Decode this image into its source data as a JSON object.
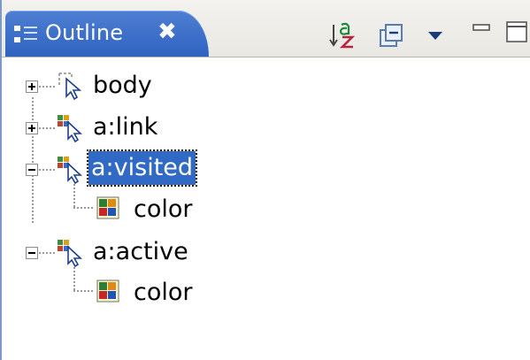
{
  "view": {
    "tab_title": "Outline",
    "close_glyph": "✖",
    "toolbar": {
      "sort_icon": "sort-alphabetically-icon",
      "collapse_icon": "collapse-all-icon",
      "menu_icon": "view-menu-dropdown-icon",
      "minimize_icon": "minimize-icon",
      "maximize_icon": "maximize-icon"
    }
  },
  "tree": {
    "nodes": [
      {
        "label": "body",
        "icon": "selector-icon",
        "state": "collapsed"
      },
      {
        "label": "a:link",
        "icon": "compound-selector-icon",
        "state": "collapsed"
      },
      {
        "label": "a:visited",
        "icon": "compound-selector-icon",
        "state": "expanded",
        "selected": true
      },
      {
        "label": "color",
        "icon": "property-icon",
        "state": "leaf"
      },
      {
        "label": "a:active",
        "icon": "compound-selector-icon",
        "state": "expanded"
      },
      {
        "label": "color",
        "icon": "property-icon",
        "state": "leaf"
      }
    ]
  },
  "colors": {
    "tab_blue": "#2f63c0",
    "selection_blue": "#316ac5",
    "header_bg": "#ece9d8"
  }
}
